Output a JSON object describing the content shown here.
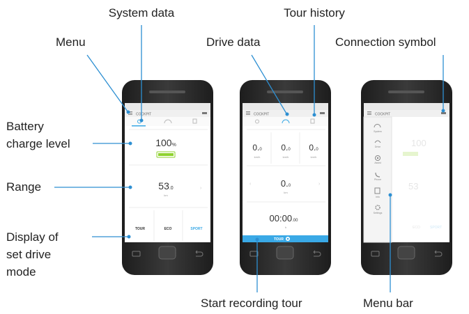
{
  "callouts": {
    "system_data": "System data",
    "tour_history": "Tour history",
    "menu": "Menu",
    "drive_data": "Drive data",
    "connection_symbol": "Connection symbol",
    "battery_line1": "Battery",
    "battery_line2": "charge level",
    "range": "Range",
    "display_line1": "Display of",
    "display_line2": "set drive",
    "display_line3": "mode",
    "start_recording": "Start recording tour",
    "menu_bar": "Menu bar"
  },
  "phone1": {
    "app_title": "COCKPIT",
    "battery_value": "100",
    "battery_unit": "%",
    "range_value": "53",
    "range_decimal": ".0",
    "range_unit": "km",
    "mode_tour": "TOUR",
    "mode_eco": "ECO",
    "mode_sport": "SPORT"
  },
  "phone2": {
    "app_title": "COCKPIT",
    "speed1": "0.",
    "speed1_dec": "0",
    "speed1_unit": "km/h",
    "speed2": "0.",
    "speed2_dec": "0",
    "speed2_unit": "km/h",
    "speed3": "0.",
    "speed3_dec": "0",
    "speed3_unit": "km/h",
    "distance": "0.",
    "distance_dec": "0",
    "distance_unit": "km",
    "time": "00:00",
    "time_dec": ".00",
    "time_unit": "h",
    "tour_button": "TOUR"
  },
  "phone3": {
    "app_title": "COCKPIT",
    "menu_items": [
      "System",
      "Drive",
      "Assist",
      "Phone",
      "Info",
      "Settings"
    ]
  },
  "colors": {
    "accent_blue": "#3aa9e6",
    "battery_green": "#8fd22f",
    "phone_body": "#2b2b2b",
    "callout_line": "#2d8fd2"
  }
}
